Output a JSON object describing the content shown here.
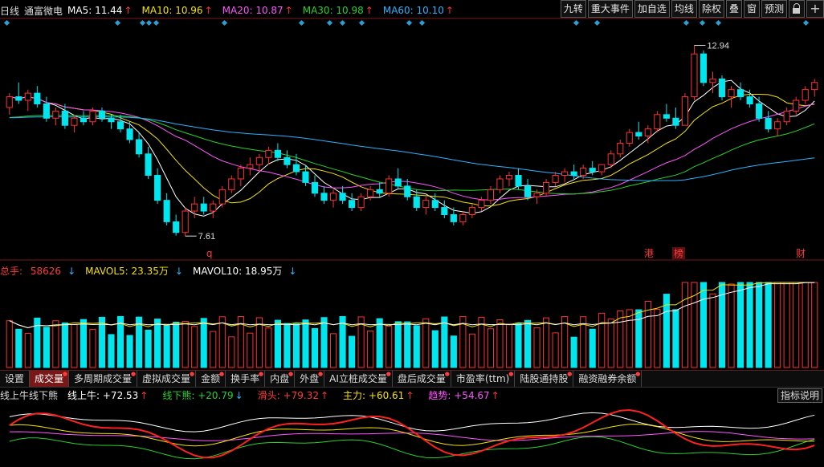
{
  "main_legend": {
    "period": "日线",
    "stock": "通富微电",
    "ma": [
      {
        "label": "MA5: 11.44",
        "color": "#ffffff",
        "dir": "up"
      },
      {
        "label": "MA10: 10.96",
        "color": "#f5e200",
        "dir": "up"
      },
      {
        "label": "MA20: 10.87",
        "color": "#ff55ff",
        "dir": "up"
      },
      {
        "label": "MA30: 10.98",
        "color": "#28d228",
        "dir": "up"
      },
      {
        "label": "MA60: 10.10",
        "color": "#2ab3ff",
        "dir": "up"
      }
    ]
  },
  "toolbar": {
    "buttons": [
      "九转",
      "重大事件",
      "加自选",
      "均线",
      "除权",
      "叠",
      "窗",
      "预测"
    ]
  },
  "price_annotations": {
    "high": "12.94",
    "low": "7.61"
  },
  "event_tags": {
    "hk": "港",
    "bang": "榜",
    "cai": "财",
    "q": "q"
  },
  "vol_legend": {
    "total_label": "总手:",
    "total_value": "58626",
    "mavol5": "MAVOL5: 23.35万",
    "mavol10": "MAVOL10: 18.95万"
  },
  "tabs": [
    "设置",
    "成交量",
    "多周期成交量",
    "虚拟成交量",
    "金额",
    "换手率",
    "内盘",
    "外盘",
    "AI立桩成交量",
    "盘后成交量",
    "市盈率(ttm)",
    "陆股通持股",
    "融资融券余额"
  ],
  "active_tab": 1,
  "indicator_legend": {
    "name": "线上牛线下熊",
    "items": [
      {
        "label": "线上牛: +72.53",
        "color": "#ffffff",
        "dir": "up"
      },
      {
        "label": "线下熊: +20.79",
        "color": "#28d228",
        "dir": "dn"
      },
      {
        "label": "滑头: +79.32",
        "color": "#ff3b3b",
        "dir": "up"
      },
      {
        "label": "主力: +60.61",
        "color": "#f5e200",
        "dir": "up"
      },
      {
        "label": "趋势: +54.67",
        "color": "#ff55ff",
        "dir": "up"
      }
    ],
    "help": "指标说明"
  },
  "colors": {
    "up": "#ff3030",
    "down": "#00e5ee",
    "grid": "#7a1a1a"
  },
  "chart_data": {
    "type": "candlestick",
    "candles": [
      [
        11.2,
        11.6,
        11.0,
        11.5
      ],
      [
        11.5,
        11.9,
        11.3,
        11.4
      ],
      [
        11.4,
        11.7,
        11.1,
        11.6
      ],
      [
        11.6,
        11.8,
        11.2,
        11.3
      ],
      [
        11.3,
        11.5,
        10.8,
        10.9
      ],
      [
        10.9,
        11.2,
        10.7,
        11.1
      ],
      [
        11.1,
        11.3,
        10.6,
        10.7
      ],
      [
        10.7,
        11.0,
        10.5,
        10.9
      ],
      [
        10.9,
        11.1,
        10.7,
        10.8
      ],
      [
        10.8,
        11.2,
        10.7,
        11.1
      ],
      [
        11.1,
        11.2,
        10.8,
        10.9
      ],
      [
        10.9,
        11.0,
        10.6,
        10.8
      ],
      [
        10.8,
        11.0,
        10.5,
        10.6
      ],
      [
        10.6,
        10.8,
        10.2,
        10.3
      ],
      [
        10.3,
        10.5,
        9.8,
        9.9
      ],
      [
        9.9,
        10.1,
        9.2,
        9.3
      ],
      [
        9.3,
        9.5,
        8.5,
        8.6
      ],
      [
        8.6,
        8.8,
        7.9,
        8.0
      ],
      [
        8.0,
        8.2,
        7.61,
        7.7
      ],
      [
        7.7,
        8.4,
        7.6,
        8.3
      ],
      [
        8.3,
        8.7,
        8.1,
        8.5
      ],
      [
        8.5,
        8.7,
        8.2,
        8.3
      ],
      [
        8.3,
        8.6,
        8.1,
        8.5
      ],
      [
        8.5,
        9.0,
        8.4,
        8.9
      ],
      [
        8.9,
        9.3,
        8.8,
        9.2
      ],
      [
        9.2,
        9.6,
        9.0,
        9.5
      ],
      [
        9.5,
        9.8,
        9.3,
        9.6
      ],
      [
        9.6,
        9.9,
        9.4,
        9.8
      ],
      [
        9.8,
        10.1,
        9.6,
        10.0
      ],
      [
        10.0,
        10.2,
        9.7,
        9.8
      ],
      [
        9.8,
        10.0,
        9.5,
        9.6
      ],
      [
        9.6,
        9.9,
        9.3,
        9.4
      ],
      [
        9.4,
        9.6,
        9.0,
        9.1
      ],
      [
        9.1,
        9.3,
        8.7,
        8.8
      ],
      [
        8.8,
        9.0,
        8.5,
        8.6
      ],
      [
        8.6,
        8.9,
        8.4,
        8.8
      ],
      [
        8.8,
        9.0,
        8.5,
        8.6
      ],
      [
        8.6,
        8.8,
        8.3,
        8.4
      ],
      [
        8.4,
        8.8,
        8.3,
        8.7
      ],
      [
        8.7,
        9.0,
        8.6,
        8.9
      ],
      [
        8.9,
        9.1,
        8.7,
        8.8
      ],
      [
        8.8,
        9.3,
        8.7,
        9.2
      ],
      [
        9.2,
        9.5,
        8.9,
        9.0
      ],
      [
        9.0,
        9.2,
        8.6,
        8.7
      ],
      [
        8.7,
        8.9,
        8.3,
        8.4
      ],
      [
        8.4,
        8.7,
        8.2,
        8.6
      ],
      [
        8.6,
        8.8,
        8.3,
        8.4
      ],
      [
        8.4,
        8.6,
        8.1,
        8.2
      ],
      [
        8.2,
        8.4,
        7.9,
        8.0
      ],
      [
        8.0,
        8.3,
        7.9,
        8.2
      ],
      [
        8.2,
        8.5,
        8.1,
        8.4
      ],
      [
        8.4,
        8.7,
        8.3,
        8.6
      ],
      [
        8.6,
        9.0,
        8.5,
        8.9
      ],
      [
        8.9,
        9.3,
        8.8,
        9.2
      ],
      [
        9.2,
        9.4,
        9.0,
        9.3
      ],
      [
        9.3,
        9.5,
        8.9,
        9.0
      ],
      [
        9.0,
        9.2,
        8.6,
        8.7
      ],
      [
        8.7,
        8.9,
        8.5,
        8.8
      ],
      [
        8.8,
        9.2,
        8.7,
        9.1
      ],
      [
        9.1,
        9.4,
        9.0,
        9.3
      ],
      [
        9.3,
        9.5,
        9.1,
        9.4
      ],
      [
        9.4,
        9.6,
        9.2,
        9.3
      ],
      [
        9.3,
        9.6,
        9.2,
        9.5
      ],
      [
        9.5,
        9.7,
        9.3,
        9.4
      ],
      [
        9.4,
        9.6,
        9.3,
        9.6
      ],
      [
        9.6,
        10.0,
        9.5,
        9.9
      ],
      [
        9.9,
        10.3,
        9.8,
        10.2
      ],
      [
        10.2,
        10.6,
        10.1,
        10.5
      ],
      [
        10.5,
        10.8,
        10.3,
        10.4
      ],
      [
        10.4,
        10.7,
        10.2,
        10.6
      ],
      [
        10.6,
        11.1,
        10.5,
        11.0
      ],
      [
        11.0,
        11.3,
        10.8,
        10.9
      ],
      [
        10.9,
        11.2,
        10.6,
        10.7
      ],
      [
        10.7,
        11.6,
        10.7,
        11.5
      ],
      [
        11.5,
        12.94,
        11.4,
        12.7
      ],
      [
        12.7,
        12.8,
        11.8,
        11.9
      ],
      [
        11.9,
        12.2,
        11.6,
        12.0
      ],
      [
        12.0,
        12.1,
        11.4,
        11.5
      ],
      [
        11.5,
        11.8,
        11.2,
        11.7
      ],
      [
        11.7,
        11.9,
        11.4,
        11.5
      ],
      [
        11.5,
        11.7,
        11.2,
        11.3
      ],
      [
        11.3,
        11.5,
        10.8,
        10.9
      ],
      [
        10.9,
        11.1,
        10.5,
        10.6
      ],
      [
        10.6,
        10.9,
        10.4,
        10.8
      ],
      [
        10.8,
        11.2,
        10.7,
        11.1
      ],
      [
        11.1,
        11.5,
        11.0,
        11.4
      ],
      [
        11.4,
        11.8,
        11.3,
        11.7
      ],
      [
        11.7,
        12.0,
        11.5,
        11.9
      ]
    ],
    "xlabel": "",
    "ylabel": ""
  }
}
